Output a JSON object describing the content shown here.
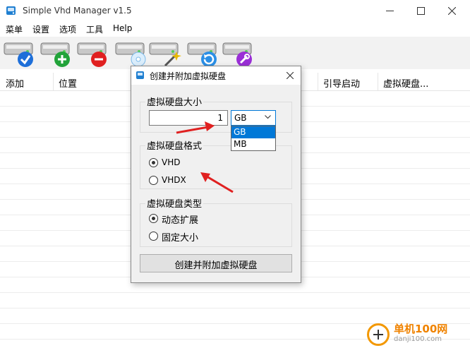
{
  "window": {
    "title": "Simple Vhd Manager v1.5"
  },
  "menu": [
    "菜单",
    "设置",
    "选项",
    "工具",
    "Help"
  ],
  "toolbar": {
    "buttons": [
      {
        "name": "check",
        "badge": "#1e6fd9"
      },
      {
        "name": "add",
        "badge": "#22a33a"
      },
      {
        "name": "remove",
        "badge": "#e02020"
      },
      {
        "name": "disk",
        "badge": "#7ab8e8"
      },
      {
        "name": "magic",
        "badge": "#e8b800"
      },
      {
        "name": "refresh",
        "badge": "#2b8fe6"
      },
      {
        "name": "settings",
        "badge": "#9a2fd6"
      }
    ]
  },
  "list": {
    "columns": [
      "添加",
      "位置",
      "引导启动",
      "虚拟硬盘..."
    ]
  },
  "dialog": {
    "title": "创建并附加虚拟硬盘",
    "size_group": {
      "label": "虚拟硬盘大小",
      "value": "1",
      "unit": "GB",
      "options": [
        "GB",
        "MB"
      ],
      "selected": "GB"
    },
    "format_group": {
      "label": "虚拟硬盘格式",
      "options": [
        "VHD",
        "VHDX"
      ],
      "selected": "VHD"
    },
    "type_group": {
      "label": "虚拟硬盘类型",
      "options": [
        "动态扩展",
        "固定大小"
      ],
      "selected": "动态扩展"
    },
    "action_label": "创建并附加虚拟硬盘"
  },
  "watermark": {
    "brand": "单机100网",
    "url": "danji100.com"
  },
  "colors": {
    "annotation_arrow": "#e02020",
    "select_blue": "#0078d7",
    "watermark_orange": "#f08300"
  }
}
